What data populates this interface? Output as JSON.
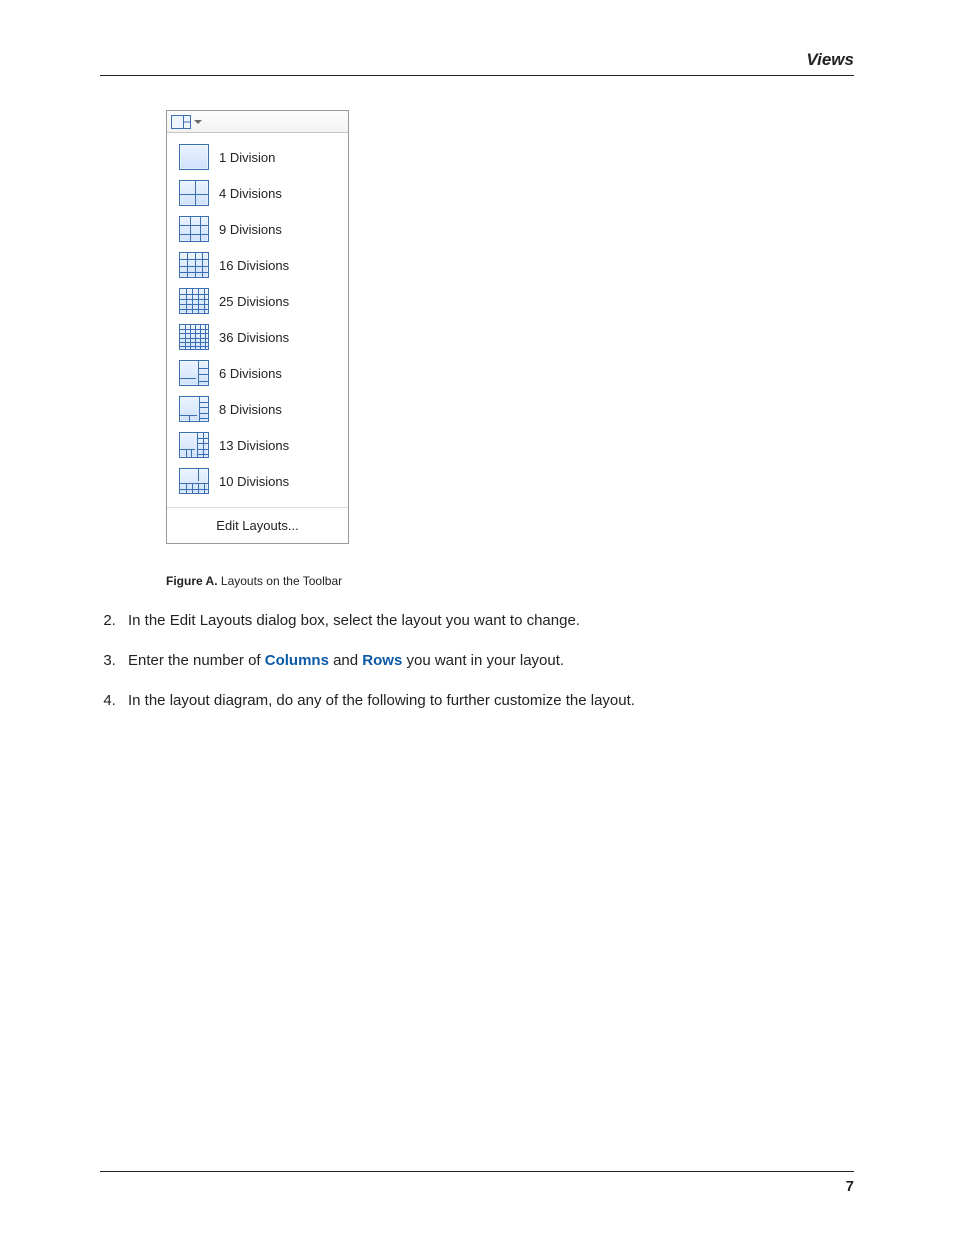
{
  "header": {
    "section_title": "Views"
  },
  "dropdown": {
    "items": [
      {
        "label": "1 Division",
        "grid": [
          1,
          1
        ]
      },
      {
        "label": "4 Divisions",
        "grid": [
          2,
          2
        ]
      },
      {
        "label": "9 Divisions",
        "grid": [
          3,
          3
        ]
      },
      {
        "label": "16 Divisions",
        "grid": [
          4,
          4
        ]
      },
      {
        "label": "25 Divisions",
        "grid": [
          5,
          5
        ]
      },
      {
        "label": "36 Divisions",
        "grid": [
          6,
          6
        ]
      },
      {
        "label": "6 Divisions",
        "grid": "1main-5side"
      },
      {
        "label": "8 Divisions",
        "grid": "1main-7side"
      },
      {
        "label": "13 Divisions",
        "grid": "1main-12side"
      },
      {
        "label": "10 Divisions",
        "grid": "1main-bottom"
      }
    ],
    "footer_label": "Edit Layouts..."
  },
  "figure": {
    "label": "Figure A.",
    "caption": "Layouts on the Toolbar"
  },
  "steps": {
    "start": 2,
    "items": [
      {
        "pre": "In the Edit Layouts dialog box, select the layout you want to change."
      },
      {
        "pre": "Enter the number of ",
        "kw1": "Columns",
        "mid": " and ",
        "kw2": "Rows",
        "post": " you want in your layout."
      },
      {
        "pre": "In the layout diagram, do any of the following to further customize the layout."
      }
    ]
  },
  "footer": {
    "page_number": "7"
  }
}
